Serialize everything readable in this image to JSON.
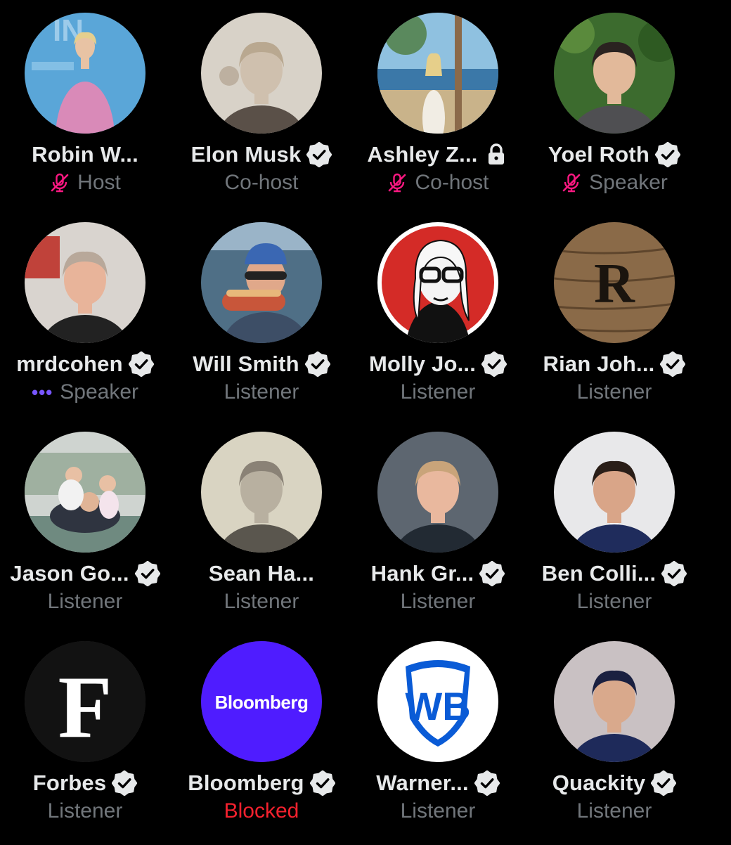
{
  "colors": {
    "background": "#000000",
    "name_text": "#e7e9ea",
    "role_text": "#71767b",
    "blocked_text": "#f4212e",
    "muted_mic": "#f91880",
    "speaking_dots": "#7856ff",
    "verified_badge": "#e7e9ea"
  },
  "participants": [
    {
      "name": "Robin W...",
      "role": "Host",
      "status_icon": "muted-mic-icon",
      "badge_icon": ""
    },
    {
      "name": "Elon Musk",
      "role": "Co-host",
      "status_icon": "",
      "badge_icon": "verified-badge-icon"
    },
    {
      "name": "Ashley Z...",
      "role": "Co-host",
      "status_icon": "muted-mic-icon",
      "badge_icon": "lock-icon"
    },
    {
      "name": "Yoel Roth",
      "role": "Speaker",
      "status_icon": "muted-mic-icon",
      "badge_icon": "verified-badge-icon"
    },
    {
      "name": "mrdcohen",
      "role": "Speaker",
      "status_icon": "speaking-dots-icon",
      "badge_icon": "verified-badge-icon"
    },
    {
      "name": "Will Smith",
      "role": "Listener",
      "status_icon": "",
      "badge_icon": "verified-badge-icon"
    },
    {
      "name": "Molly Jo...",
      "role": "Listener",
      "status_icon": "",
      "badge_icon": "verified-badge-icon"
    },
    {
      "name": "Rian Joh...",
      "role": "Listener",
      "status_icon": "",
      "badge_icon": "verified-badge-icon"
    },
    {
      "name": "Jason Go...",
      "role": "Listener",
      "status_icon": "",
      "badge_icon": "verified-badge-icon"
    },
    {
      "name": "Sean Ha...",
      "role": "Listener",
      "status_icon": "",
      "badge_icon": ""
    },
    {
      "name": "Hank Gr...",
      "role": "Listener",
      "status_icon": "",
      "badge_icon": "verified-badge-icon"
    },
    {
      "name": "Ben Colli...",
      "role": "Listener",
      "status_icon": "",
      "badge_icon": "verified-badge-icon"
    },
    {
      "name": "Forbes",
      "role": "Listener",
      "status_icon": "",
      "badge_icon": "verified-badge-icon",
      "avatar_text": "F"
    },
    {
      "name": "Bloomberg",
      "role": "Blocked",
      "status_icon": "",
      "badge_icon": "verified-badge-icon",
      "avatar_text": "Bloomberg"
    },
    {
      "name": "Warner...",
      "role": "Listener",
      "status_icon": "",
      "badge_icon": "verified-badge-icon",
      "avatar_text": "WB"
    },
    {
      "name": "Quackity",
      "role": "Listener",
      "status_icon": "",
      "badge_icon": "verified-badge-icon"
    }
  ],
  "avatar_icons": [
    "robin-avatar-icon",
    "elon-avatar-icon",
    "ashley-avatar-icon",
    "yoel-avatar-icon",
    "mrdcohen-avatar-icon",
    "will-smith-avatar-icon",
    "molly-avatar-icon",
    "rian-avatar-icon",
    "jason-avatar-icon",
    "sean-avatar-icon",
    "hank-avatar-icon",
    "ben-avatar-icon",
    "forbes-logo-icon",
    "bloomberg-logo-icon",
    "warner-bros-logo-icon",
    "quackity-avatar-icon"
  ]
}
